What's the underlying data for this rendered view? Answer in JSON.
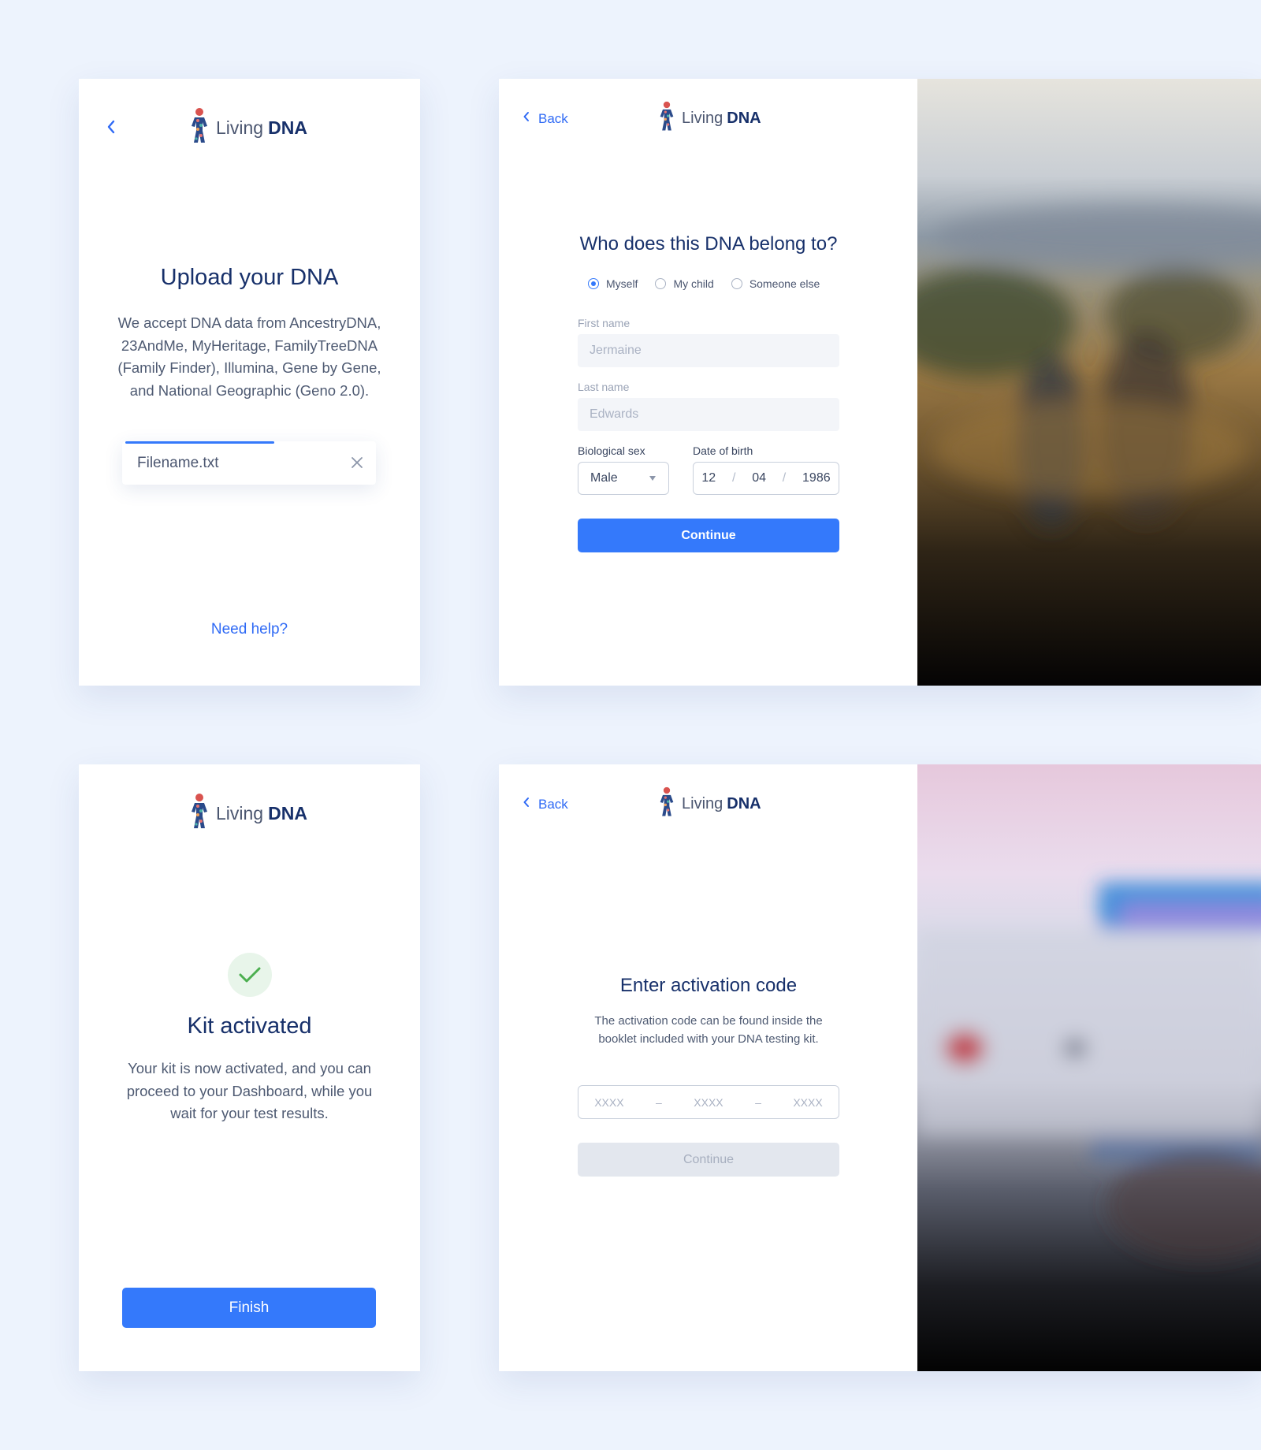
{
  "brand": {
    "living": "Living",
    "dna": "DNA"
  },
  "colors": {
    "accent": "#3479fb",
    "navy": "#17306a",
    "success": "#4caf50",
    "background": "#edf3fd"
  },
  "upload": {
    "title": "Upload your DNA",
    "description": "We accept DNA data from AncestryDNA, 23AndMe, MyHeritage, FamilyTreeDNA (Family Finder), Illumina, Gene by Gene, and National Geographic (Geno 2.0).",
    "file_name": "Filename.txt",
    "upload_progress": 0.6,
    "help_link": "Need help?"
  },
  "owner_form": {
    "back_label": "Back",
    "title": "Who does this DNA belong to?",
    "options": [
      "Myself",
      "My child",
      "Someone else"
    ],
    "selected_option": "Myself",
    "first_name_label": "First name",
    "first_name_placeholder": "Jermaine",
    "last_name_label": "Last name",
    "last_name_placeholder": "Edwards",
    "sex_label": "Biological sex",
    "sex_value": "Male",
    "dob_label": "Date of birth",
    "dob_day": "12",
    "dob_month": "04",
    "dob_year": "1986",
    "date_separator": "/",
    "continue_label": "Continue"
  },
  "kit_activated": {
    "title": "Kit activated",
    "description": "Your kit is now activated, and you can proceed to your Dashboard, while you wait for your test results.",
    "finish_label": "Finish"
  },
  "activation": {
    "back_label": "Back",
    "title": "Enter activation code",
    "description": "The activation code can be found inside the booklet included with your DNA testing kit.",
    "code_placeholder": "XXXX",
    "code_separator": "–",
    "continue_label": "Continue"
  }
}
